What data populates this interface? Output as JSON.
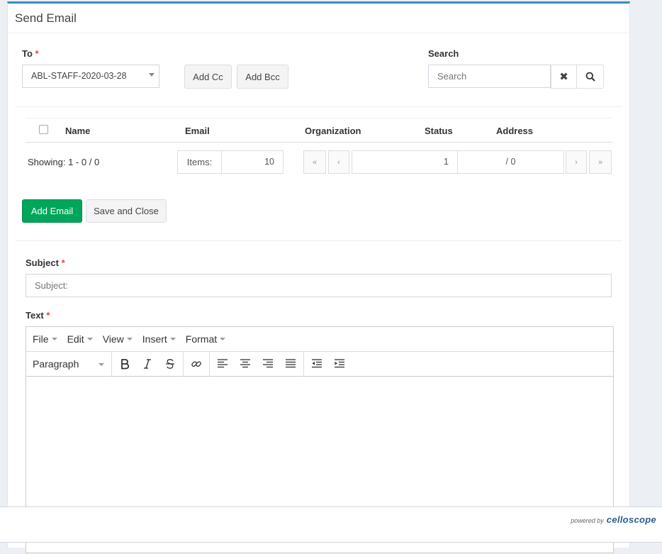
{
  "panel": {
    "title": "Send Email"
  },
  "to": {
    "label": "To",
    "required": "*",
    "selected": "ABL-STAFF-2020-03-28"
  },
  "buttons": {
    "add_cc": "Add Cc",
    "add_bcc": "Add Bcc",
    "add_email": "Add Email",
    "save_close": "Save and Close"
  },
  "search": {
    "label": "Search",
    "placeholder": "Search"
  },
  "table": {
    "columns": [
      "Name",
      "Email",
      "Organization",
      "Status",
      "Address"
    ]
  },
  "pagination": {
    "showing": "Showing: 1 - 0 / 0",
    "items_label": "Items:",
    "items_value": "10",
    "first": "«",
    "prev": "‹",
    "page": "1",
    "total": "/ 0",
    "next": "›",
    "last": "»"
  },
  "subject": {
    "label": "Subject",
    "required": "*",
    "placeholder": "Subject:"
  },
  "text": {
    "label": "Text",
    "required": "*"
  },
  "editor": {
    "menu": [
      "File",
      "Edit",
      "View",
      "Insert",
      "Format"
    ],
    "block_format": "Paragraph"
  },
  "footer": {
    "powered_by": "powered by",
    "brand": "celloscope"
  }
}
